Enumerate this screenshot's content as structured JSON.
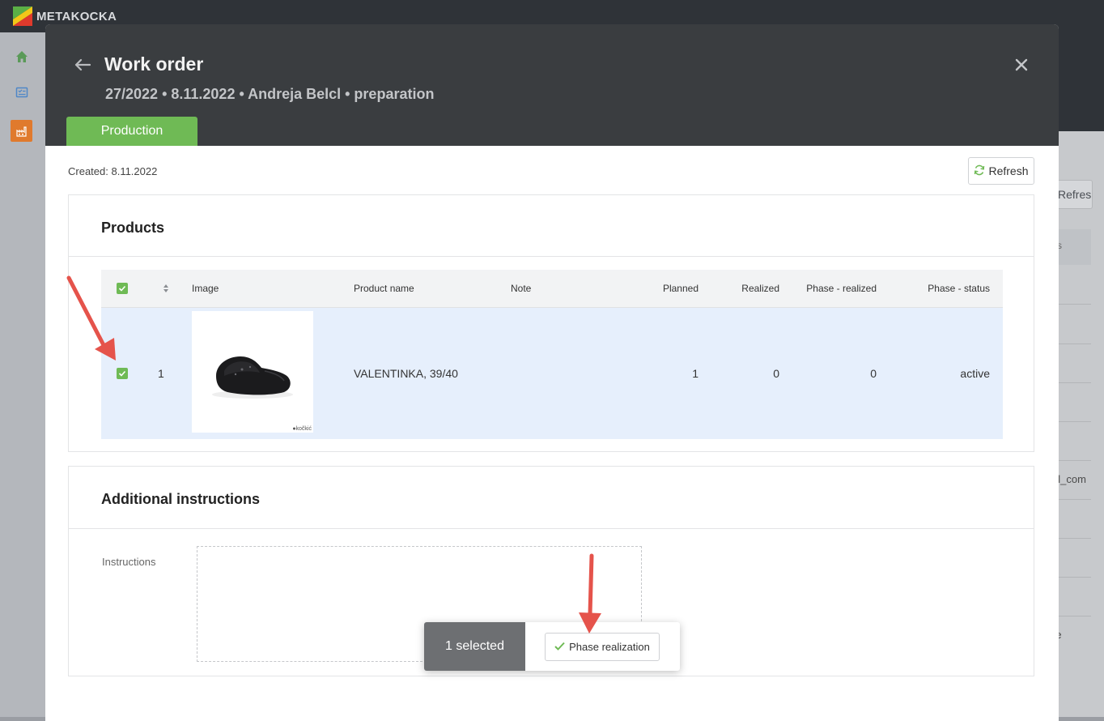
{
  "app": {
    "brand": "METAKOCKA"
  },
  "sidebar": {
    "items": [
      {
        "name": "home",
        "color": "#5a9a58"
      },
      {
        "name": "tasks",
        "color": "#4f87c7"
      },
      {
        "name": "factory",
        "color": "#e07a2d"
      }
    ]
  },
  "background": {
    "refresh_label": "Refresh",
    "col_head_fragment": "s",
    "cell_fragment_1": "al_com",
    "cell_fragment_2": "re"
  },
  "modal": {
    "title": "Work order",
    "subtitle": "27/2022 • 8.11.2022 • Andreja Belcl • preparation",
    "tab_label": "Production",
    "created": "Created: 8.11.2022",
    "refresh_label": "Refresh",
    "products": {
      "title": "Products",
      "columns": {
        "image": "Image",
        "product_name": "Product name",
        "note": "Note",
        "planned": "Planned",
        "realized": "Realized",
        "phase_realized": "Phase - realized",
        "phase_status": "Phase - status"
      },
      "rows": [
        {
          "index": "1",
          "checked": true,
          "product_name": "VALENTINKA, 39/40",
          "note": "",
          "planned": "1",
          "realized": "0",
          "phase_realized": "0",
          "phase_status": "active",
          "image_watermark": "●kočkić"
        }
      ]
    },
    "additional": {
      "title": "Additional instructions",
      "instructions_label": "Instructions",
      "instructions_value": ""
    }
  },
  "selection_bar": {
    "count_label": "1 selected",
    "action_label": "Phase realization"
  },
  "colors": {
    "accent_green": "#6fba55",
    "header_dark": "#3a3d40",
    "row_selected": "#e6effc",
    "annotation_arrow": "#e5534b"
  }
}
